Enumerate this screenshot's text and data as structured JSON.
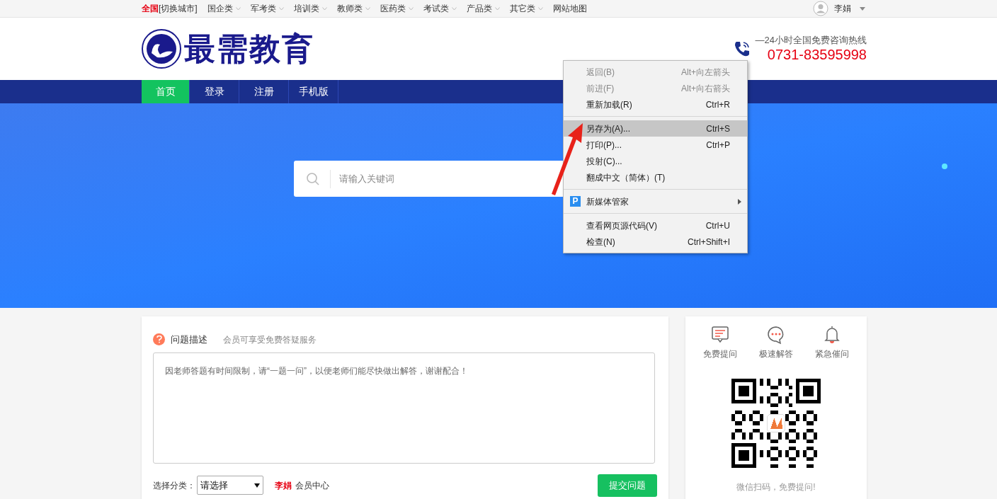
{
  "top_bar": {
    "city": "全国",
    "switch_city": "[切换城市]",
    "menus": [
      {
        "label": "国企类",
        "kind": "dropdown"
      },
      {
        "label": "军考类",
        "kind": "dropdown"
      },
      {
        "label": "培训类",
        "kind": "dropdown"
      },
      {
        "label": "教师类",
        "kind": "dropdown"
      },
      {
        "label": "医药类",
        "kind": "dropdown"
      },
      {
        "label": "考试类",
        "kind": "dropdown"
      },
      {
        "label": "产品类",
        "kind": "dropdown"
      },
      {
        "label": "其它类",
        "kind": "dropdown"
      },
      {
        "label": "网站地图",
        "kind": "link"
      }
    ],
    "user": "李娟"
  },
  "header": {
    "logo_text": "最需教育",
    "hotline_label": "—24小时全国免费咨询热线",
    "phone": "0731-83595998"
  },
  "nav": [
    {
      "label": "首页",
      "selected": true
    },
    {
      "label": "登录",
      "selected": false
    },
    {
      "label": "注册",
      "selected": false
    },
    {
      "label": "手机版",
      "selected": false
    }
  ],
  "search": {
    "placeholder": "请输入关键词"
  },
  "context_menu": [
    {
      "kind": "item",
      "label": "返回(B)",
      "shortcut": "Alt+向左箭头",
      "disabled": true,
      "selected": false
    },
    {
      "kind": "item",
      "label": "前进(F)",
      "shortcut": "Alt+向右箭头",
      "disabled": true,
      "selected": false
    },
    {
      "kind": "item",
      "label": "重新加载(R)",
      "shortcut": "Ctrl+R",
      "disabled": false,
      "selected": false
    },
    {
      "kind": "separator"
    },
    {
      "kind": "item",
      "label": "另存为(A)...",
      "shortcut": "Ctrl+S",
      "disabled": false,
      "selected": true
    },
    {
      "kind": "item",
      "label": "打印(P)...",
      "shortcut": "Ctrl+P",
      "disabled": false,
      "selected": false
    },
    {
      "kind": "item",
      "label": "投射(C)...",
      "disabled": false,
      "selected": false
    },
    {
      "kind": "item",
      "label": "翻成中文（简体）(T)",
      "disabled": false,
      "selected": false
    },
    {
      "kind": "separator"
    },
    {
      "kind": "submenu",
      "label": "新媒体管家",
      "icon_text": "P",
      "disabled": false,
      "selected": false
    },
    {
      "kind": "separator"
    },
    {
      "kind": "item",
      "label": "查看网页源代码(V)",
      "shortcut": "Ctrl+U",
      "disabled": false,
      "selected": false
    },
    {
      "kind": "item",
      "label": "检查(N)",
      "shortcut": "Ctrl+Shift+I",
      "disabled": false,
      "selected": false
    }
  ],
  "question": {
    "title": "问题描述",
    "subtitle": "会员可享受免费答疑服务",
    "placeholder": "因老师答题有时间限制，请“一题一问”，以便老师们能尽快做出解答，谢谢配合！",
    "category_label": "选择分类：",
    "category_value": "请选择",
    "user_name": "李娟",
    "member_center": "会员中心",
    "submit": "提交问题"
  },
  "side": {
    "features": [
      {
        "kind": "chat",
        "label": "免费提问"
      },
      {
        "kind": "dots",
        "label": "极速解答"
      },
      {
        "kind": "bell",
        "label": "紧急催问"
      }
    ],
    "qr_caption": "微信扫码，免费提问!"
  }
}
